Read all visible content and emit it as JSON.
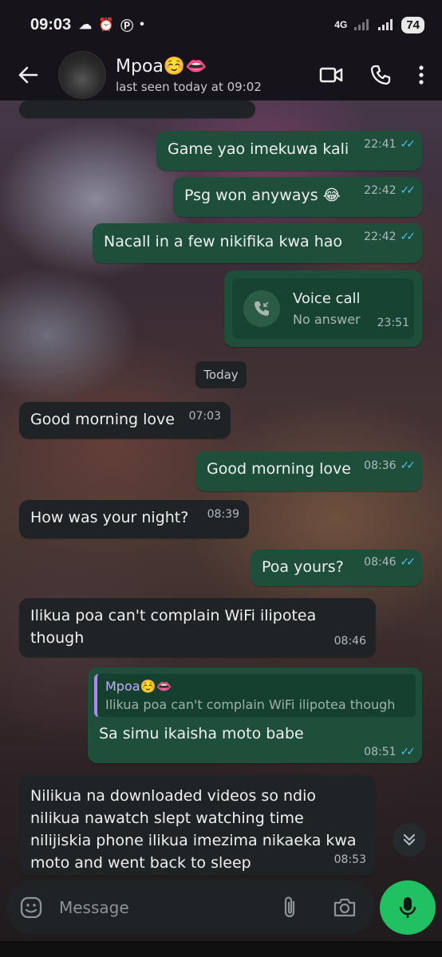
{
  "status_bar": {
    "time": "09:03",
    "network": "4G",
    "battery": "74"
  },
  "header": {
    "contact_name": "Mpoa☺️👄",
    "last_seen": "last seen today at 09:02"
  },
  "messages": [
    {
      "text": "Game yao imekuwa kali",
      "time": "22:41",
      "direction": "out"
    },
    {
      "text": "Psg won anyways 😂",
      "time": "22:42",
      "direction": "out"
    },
    {
      "text": "Nacall in a few nikifika kwa hao",
      "time": "22:42",
      "direction": "out"
    },
    {
      "title": "Voice call",
      "subtitle": "No answer",
      "time": "23:51",
      "direction": "out"
    },
    {
      "text": "Good morning love",
      "time": "07:03",
      "direction": "in"
    },
    {
      "text": "Good morning love",
      "time": "08:36",
      "direction": "out"
    },
    {
      "text": "How was your night?",
      "time": "08:39",
      "direction": "in"
    },
    {
      "text": "Poa yours?",
      "time": "08:46",
      "direction": "out"
    },
    {
      "text": "Ilikua poa can't complain WiFi ilipotea though",
      "time": "08:46",
      "direction": "in"
    },
    {
      "quote_name": "Mpoa☺️👄",
      "quote_text": "Ilikua poa can't complain WiFi ilipotea though",
      "text": "Sa simu ikaisha moto babe",
      "time": "08:51",
      "direction": "out"
    },
    {
      "text": "Nilikua na downloaded videos so ndio nilikua nawatch slept watching time nilijiskia phone ilikua imezima nikaeka kwa moto and went back to sleep",
      "time": "08:53",
      "direction": "in"
    }
  ],
  "date_chip": "Today",
  "composer": {
    "placeholder": "Message"
  },
  "colors": {
    "outgoing": "#1e4f3a",
    "incoming": "#202325",
    "accent": "#21c063",
    "ticks": "#53bdeb"
  },
  "icons": [
    "back-arrow-icon",
    "video-call-icon",
    "phone-icon",
    "more-vert-icon",
    "missed-call-icon",
    "emoji-icon",
    "attach-icon",
    "camera-icon",
    "mic-icon",
    "chevron-double-down-icon"
  ]
}
